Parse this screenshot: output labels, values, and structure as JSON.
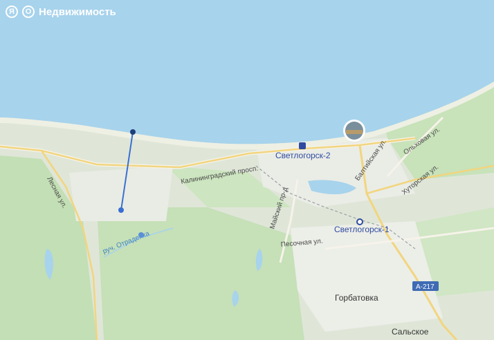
{
  "brand": {
    "logo_ya": "Я",
    "logo_o": "О",
    "title": "Недвижимость"
  },
  "labels": {
    "station_1": "Светлогорск-2",
    "station_2": "Светлогорск-1",
    "prospect": "Калининградский просп.",
    "lesnaya": "Лесная ул.",
    "baltiyskaya": "Балтийская ул.",
    "olkhovaya": "Ольховая ул.",
    "khutorskaya": "Хуторская ул.",
    "mayskiy": "Майский пр-д",
    "pesochnaya": "Песочная ул.",
    "stream": "руч. Отраденка",
    "road_badge": "А-217",
    "gorbatovka": "Горбатовка",
    "salskoe": "Сальское"
  },
  "colors": {
    "sea": "#a7d3ec",
    "land": "#dfe6d8",
    "forest": "#bfdcb1",
    "marker": "#3a6fd1"
  },
  "icons": {
    "station": "train-station-icon",
    "photo": "photo-thumbnail-icon"
  }
}
